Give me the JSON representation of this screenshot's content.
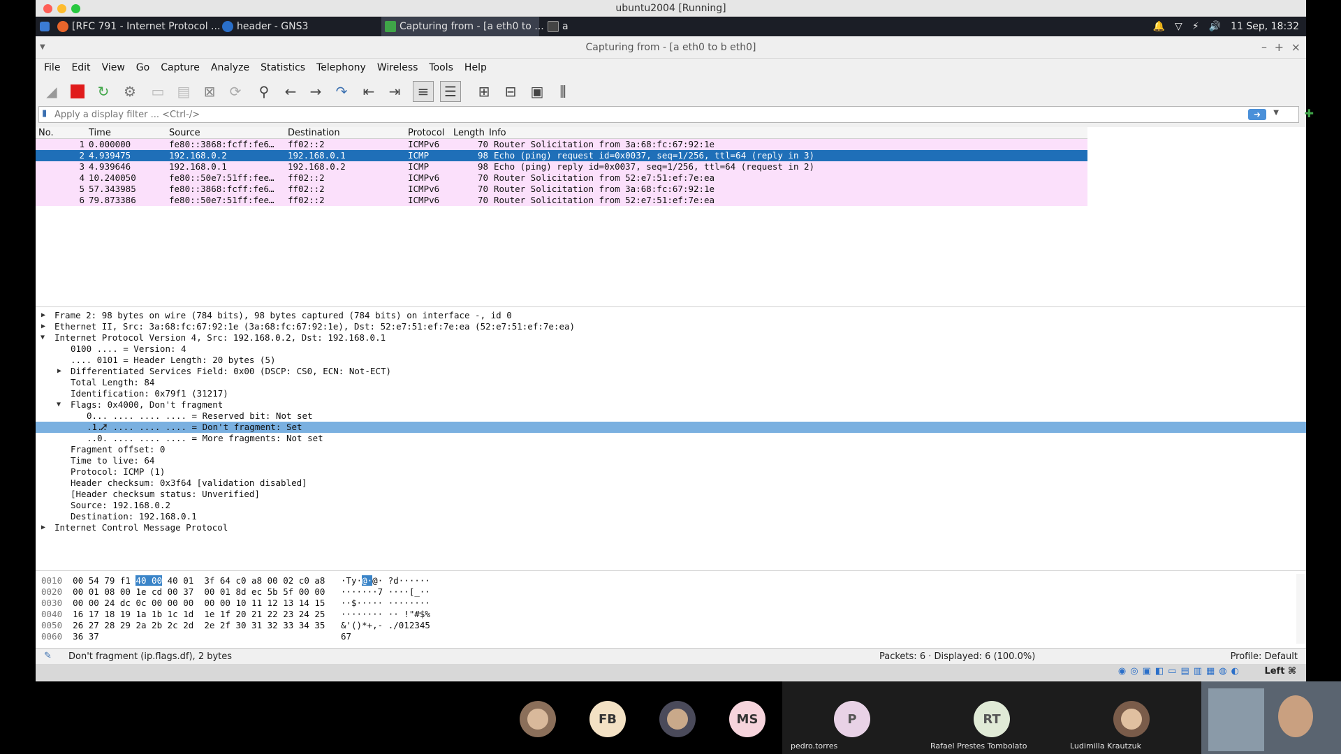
{
  "mac": {
    "title": "ubuntu2004 [Running]"
  },
  "panel": {
    "tasks": [
      {
        "label": "[RFC 791 - Internet Protocol ..."
      },
      {
        "label": "header - GNS3"
      },
      {
        "label": "Capturing from - [a eth0 to ..."
      },
      {
        "label": "a"
      }
    ],
    "datetime": "11 Sep, 18:32"
  },
  "window": {
    "title": "Capturing from - [a eth0 to b eth0]"
  },
  "menu": [
    "File",
    "Edit",
    "View",
    "Go",
    "Capture",
    "Analyze",
    "Statistics",
    "Telephony",
    "Wireless",
    "Tools",
    "Help"
  ],
  "filter": {
    "placeholder": "Apply a display filter ... <Ctrl-/>"
  },
  "columns": {
    "no": "No.",
    "time": "Time",
    "source": "Source",
    "destination": "Destination",
    "protocol": "Protocol",
    "length": "Length",
    "info": "Info"
  },
  "packets": [
    {
      "no": "1",
      "time": "0.000000",
      "source": "fe80::3868:fcff:fe6…",
      "destination": "ff02::2",
      "protocol": "ICMPv6",
      "length": "70",
      "info": "Router Solicitation from 3a:68:fc:67:92:1e"
    },
    {
      "no": "2",
      "time": "4.939475",
      "source": "192.168.0.2",
      "destination": "192.168.0.1",
      "protocol": "ICMP",
      "length": "98",
      "info": "Echo (ping) request  id=0x0037, seq=1/256, ttl=64 (reply in 3)"
    },
    {
      "no": "3",
      "time": "4.939646",
      "source": "192.168.0.1",
      "destination": "192.168.0.2",
      "protocol": "ICMP",
      "length": "98",
      "info": "Echo (ping) reply    id=0x0037, seq=1/256, ttl=64 (request in 2)"
    },
    {
      "no": "4",
      "time": "10.240050",
      "source": "fe80::50e7:51ff:fee…",
      "destination": "ff02::2",
      "protocol": "ICMPv6",
      "length": "70",
      "info": "Router Solicitation from 52:e7:51:ef:7e:ea"
    },
    {
      "no": "5",
      "time": "57.343985",
      "source": "fe80::3868:fcff:fe6…",
      "destination": "ff02::2",
      "protocol": "ICMPv6",
      "length": "70",
      "info": "Router Solicitation from 3a:68:fc:67:92:1e"
    },
    {
      "no": "6",
      "time": "79.873386",
      "source": "fe80::50e7:51ff:fee…",
      "destination": "ff02::2",
      "protocol": "ICMPv6",
      "length": "70",
      "info": "Router Solicitation from 52:e7:51:ef:7e:ea"
    }
  ],
  "details": [
    {
      "text": "Frame 2: 98 bytes on wire (784 bits), 98 bytes captured (784 bits) on interface -, id 0",
      "tree": "closed"
    },
    {
      "text": "Ethernet II, Src: 3a:68:fc:67:92:1e (3a:68:fc:67:92:1e), Dst: 52:e7:51:ef:7e:ea (52:e7:51:ef:7e:ea)",
      "tree": "closed"
    },
    {
      "text": "Internet Protocol Version 4, Src: 192.168.0.2, Dst: 192.168.0.1",
      "tree": "open"
    },
    {
      "text": "0100 .... = Version: 4",
      "tree": "none"
    },
    {
      "text": ".... 0101 = Header Length: 20 bytes (5)",
      "tree": "none"
    },
    {
      "text": "Differentiated Services Field: 0x00 (DSCP: CS0, ECN: Not-ECT)",
      "tree": "closed"
    },
    {
      "text": "Total Length: 84",
      "tree": "none"
    },
    {
      "text": "Identification: 0x79f1 (31217)",
      "tree": "none"
    },
    {
      "text": "Flags: 0x4000, Don't fragment",
      "tree": "open"
    },
    {
      "text": "0... .... .... .... = Reserved bit: Not set",
      "tree": "none"
    },
    {
      "text": ".1.. .... .... .... = Don't fragment: Set",
      "tree": "none"
    },
    {
      "text": "..0. .... .... .... = More fragments: Not set",
      "tree": "none"
    },
    {
      "text": "Fragment offset: 0",
      "tree": "none"
    },
    {
      "text": "Time to live: 64",
      "tree": "none"
    },
    {
      "text": "Protocol: ICMP (1)",
      "tree": "none"
    },
    {
      "text": "Header checksum: 0x3f64 [validation disabled]",
      "tree": "none"
    },
    {
      "text": "[Header checksum status: Unverified]",
      "tree": "none"
    },
    {
      "text": "Source: 192.168.0.2",
      "tree": "none"
    },
    {
      "text": "Destination: 192.168.0.1",
      "tree": "none"
    },
    {
      "text": "Internet Control Message Protocol",
      "tree": "closed"
    }
  ],
  "bytes": [
    {
      "offset": "0010",
      "pre": "00 54 79 f1 ",
      "hl": "40 00",
      "post": " 40 01  3f 64 c0 a8 00 02 c0 a8",
      "ascii_pre": "·Ty·",
      "ascii_hl": "@·",
      "ascii_post": "@· ?d······"
    },
    {
      "offset": "0020",
      "pre": "00 01 08 00 1e cd 00 37  00 01 8d ec 5b 5f 00 00",
      "hl": "",
      "post": "",
      "ascii_pre": "·······7 ····[_··",
      "ascii_hl": "",
      "ascii_post": ""
    },
    {
      "offset": "0030",
      "pre": "00 00 24 dc 0c 00 00 00  00 00 10 11 12 13 14 15",
      "hl": "",
      "post": "",
      "ascii_pre": "··$····· ········",
      "ascii_hl": "",
      "ascii_post": ""
    },
    {
      "offset": "0040",
      "pre": "16 17 18 19 1a 1b 1c 1d  1e 1f 20 21 22 23 24 25",
      "hl": "",
      "post": "",
      "ascii_pre": "········ ·· !\"#$%",
      "ascii_hl": "",
      "ascii_post": ""
    },
    {
      "offset": "0050",
      "pre": "26 27 28 29 2a 2b 2c 2d  2e 2f 30 31 32 33 34 35",
      "hl": "",
      "post": "",
      "ascii_pre": "&'()*+,- ./012345",
      "ascii_hl": "",
      "ascii_post": ""
    },
    {
      "offset": "0060",
      "pre": "36 37",
      "hl": "",
      "post": "",
      "ascii_pre": "67",
      "ascii_hl": "",
      "ascii_post": ""
    }
  ],
  "status": {
    "field": "Don't fragment (ip.flags.df), 2 bytes",
    "packets": "Packets: 6 · Displayed: 6 (100.0%)",
    "profile": "Profile: Default"
  },
  "vmbar": {
    "hostkey": "Left ⌘"
  },
  "meeting": {
    "initials": [
      "FB",
      "MS",
      "P",
      "RT"
    ],
    "names": [
      "pedro.torres",
      "Rafael Prestes Tombolato",
      "Ludimilla Krautzuk"
    ]
  },
  "colors": {
    "selected_row": "#1f6fb8",
    "icmp_row": "#fbe0fb",
    "detail_sel": "#7ab0e0"
  }
}
